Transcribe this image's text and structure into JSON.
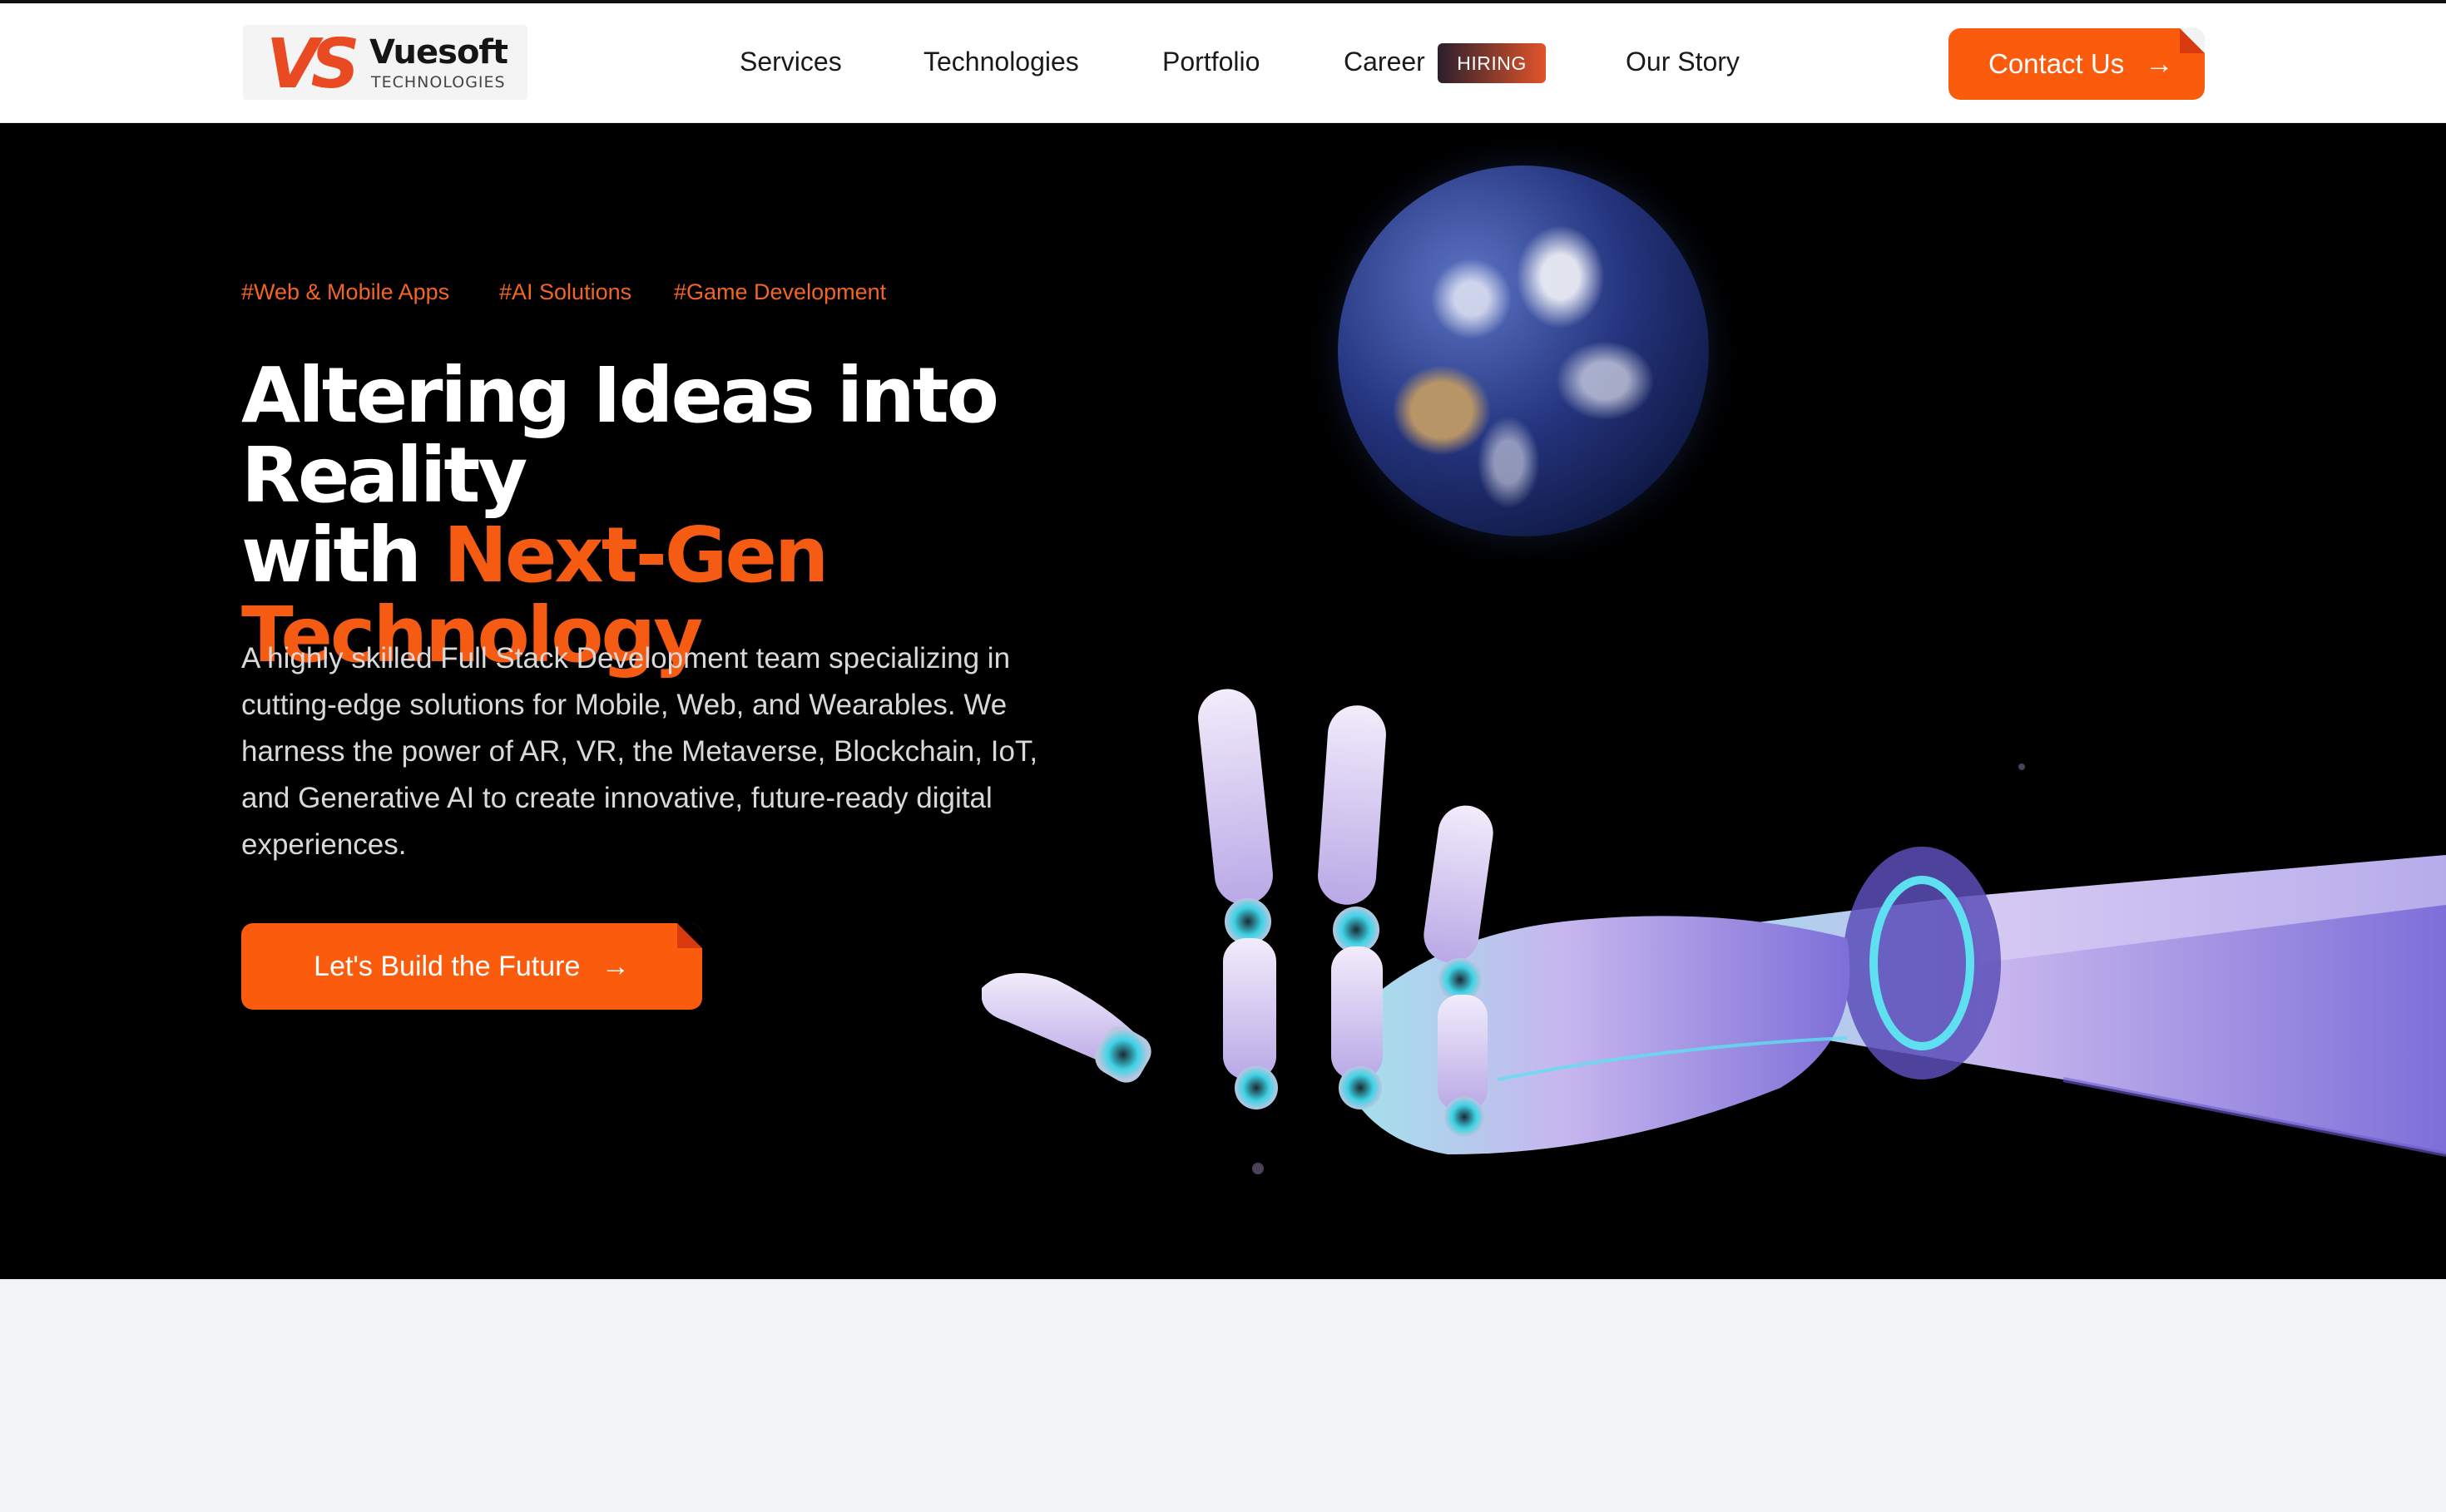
{
  "header": {
    "logo": {
      "mark": "VS",
      "name": "Vuesoft",
      "sub": "TECHNOLOGIES"
    },
    "nav": {
      "services": "Services",
      "technologies": "Technologies",
      "portfolio": "Portfolio",
      "career": "Career",
      "hiring_badge": "HIRING",
      "our_story": "Our Story"
    },
    "contact_label": "Contact Us",
    "arrow_glyph": "→"
  },
  "hero": {
    "tags": [
      "#Web & Mobile Apps",
      "#AI Solutions",
      "#Game Development"
    ],
    "headline": {
      "line1": "Altering Ideas into Reality",
      "line2_prefix": "with ",
      "line2_accent": "Next-Gen",
      "line3_accent": "Technology"
    },
    "description": "A highly skilled Full Stack Development team specializing in cutting-edge solutions for Mobile, Web, and Wearables. We harness the power of AR, VR, the Metaverse, Blockchain, IoT, and Generative AI to create innovative, future-ready digital experiences.",
    "cta_label": "Let's Build the Future",
    "images": [
      "earth",
      "robotic-hand"
    ]
  },
  "colors": {
    "accent": "#fb5b0c",
    "tag_orange": "#f26522",
    "hero_bg": "#000000",
    "page_bg": "#f2f3f5"
  }
}
